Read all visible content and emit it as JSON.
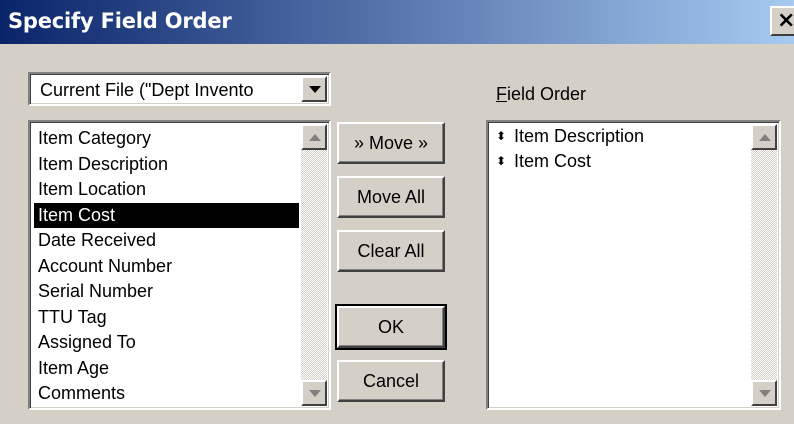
{
  "window": {
    "title": "Specify Field Order",
    "close_label": "×"
  },
  "source": {
    "selected": "Current File (\"Dept Invento"
  },
  "available_fields": {
    "items": [
      "Item Category",
      "Item Description",
      "Item Location",
      "Item Cost",
      "Date Received",
      "Account Number",
      "Serial Number",
      "TTU Tag",
      "Assigned To",
      "Item Age",
      "Comments"
    ],
    "selected_index": 3
  },
  "buttons": {
    "move": "» Move »",
    "move_all": "Move All",
    "clear_all": "Clear All",
    "ok": "OK",
    "cancel": "Cancel"
  },
  "field_order": {
    "label_mnemonic": "F",
    "label_rest": "ield Order",
    "items": [
      "Item Description",
      "Item Cost"
    ],
    "item_marker": "⬍"
  },
  "colors": {
    "title_start": "#0a246a",
    "title_end": "#a6caf0",
    "face": "#d4d0c8",
    "selection": "#000000"
  }
}
